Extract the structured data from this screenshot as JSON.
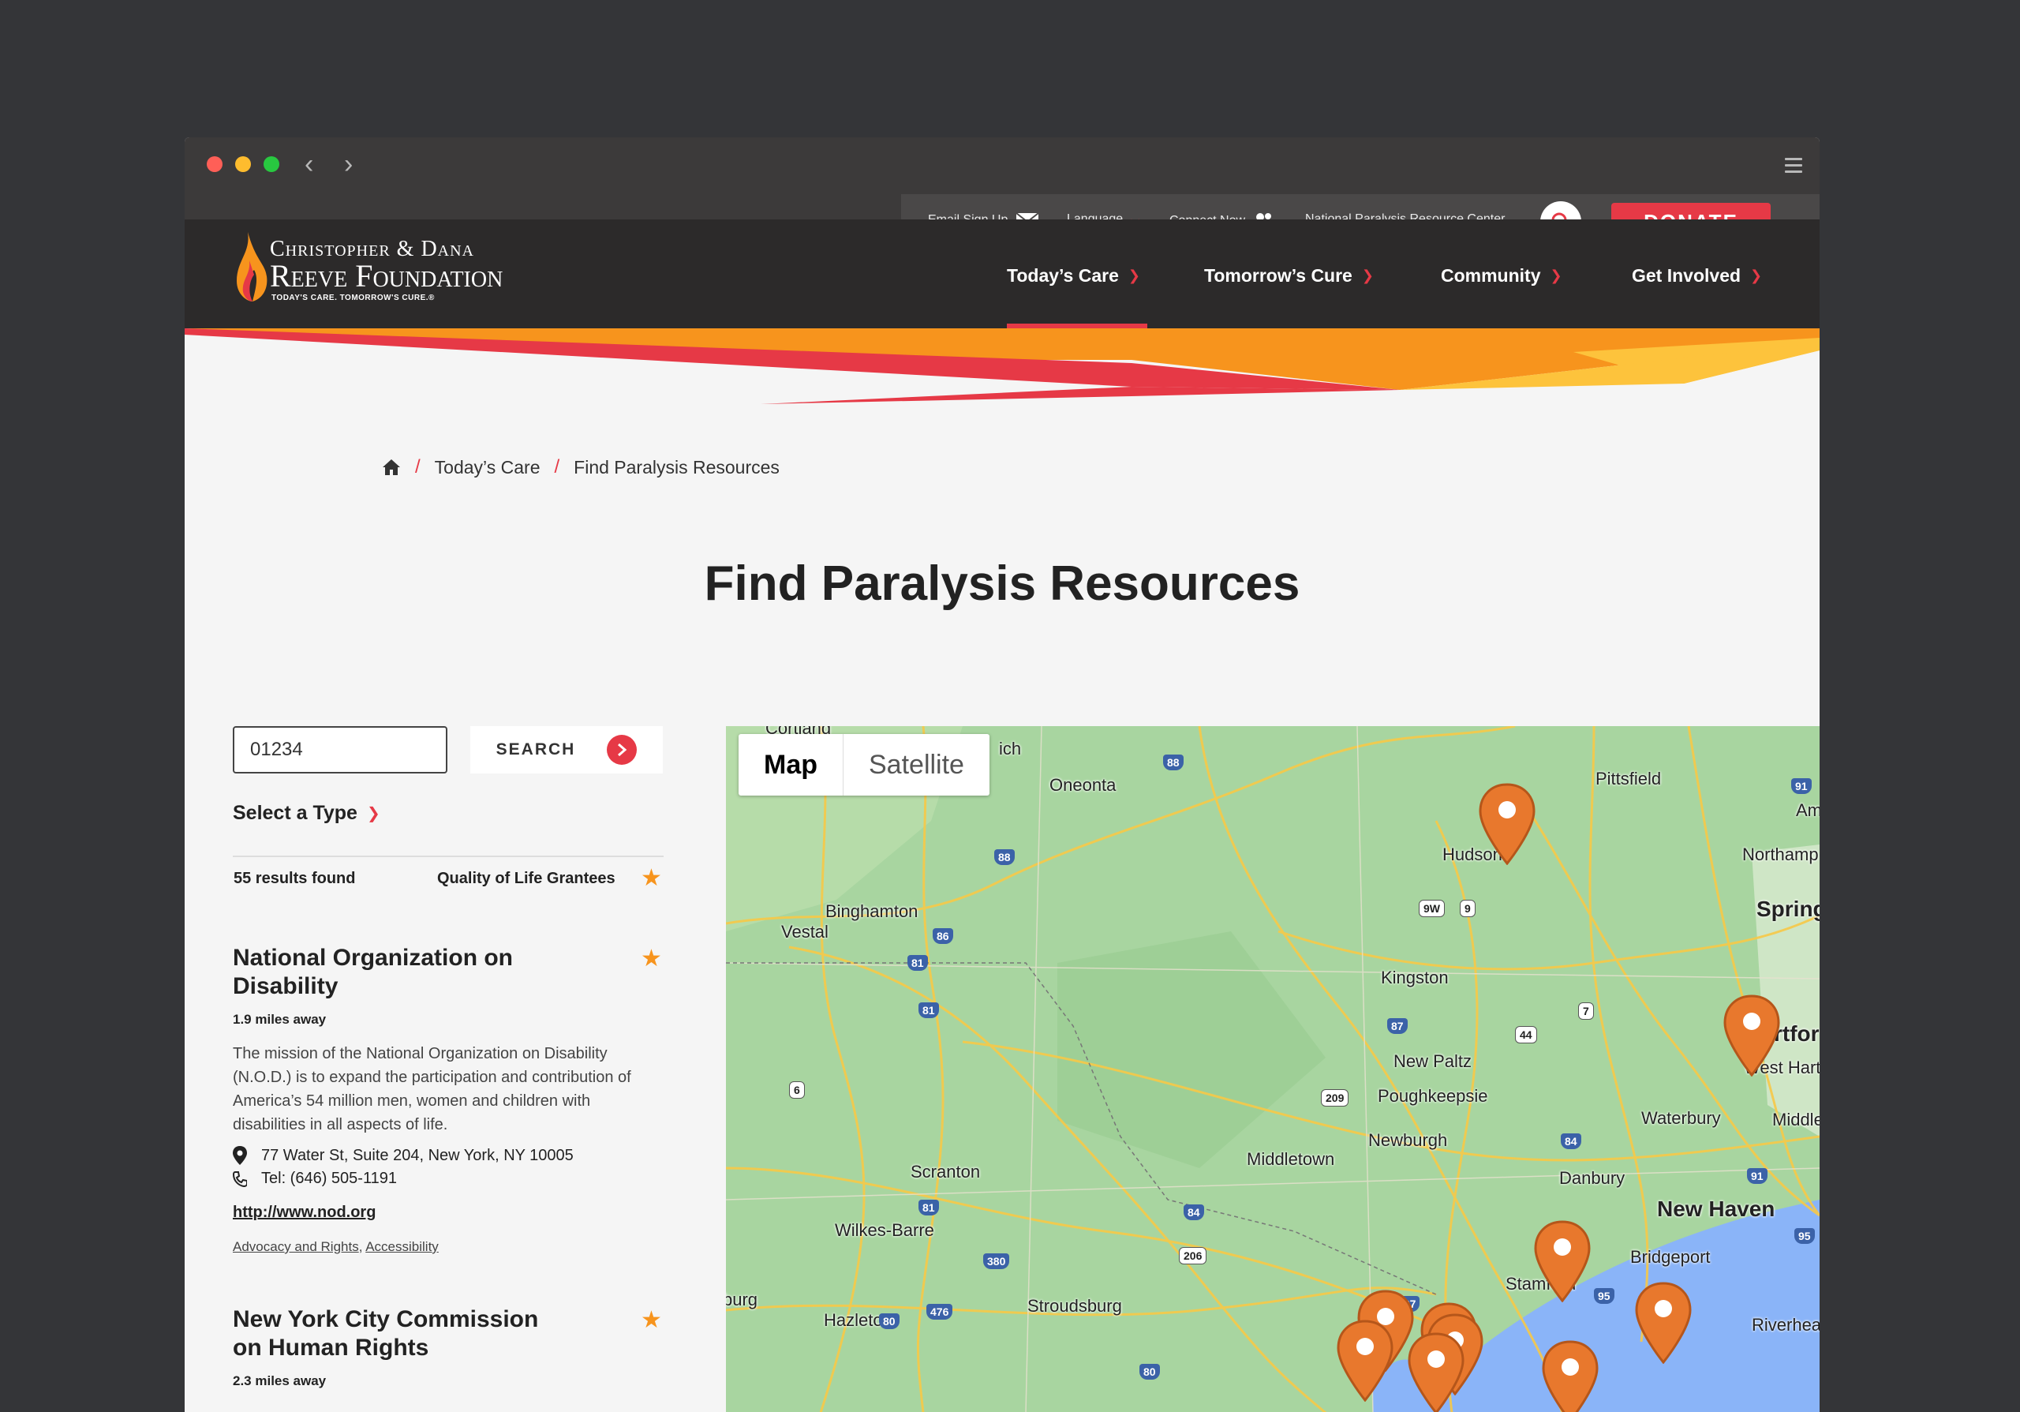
{
  "browser": {
    "back_glyph": "‹",
    "forward_glyph": "›"
  },
  "utility_nav": {
    "email_signup": "Email Sign Up",
    "language": "Language",
    "connect_now": "Connect Now",
    "resource_center": "National Paralysis Resource Center",
    "donate": "DONATE"
  },
  "logo": {
    "line1": "Christopher & Dana",
    "line2": "Reeve Foundation",
    "tagline": "TODAY'S CARE. TOMORROW'S CURE.®"
  },
  "main_nav": {
    "items": [
      {
        "label": "Today’s Care"
      },
      {
        "label": "Tomorrow’s Cure"
      },
      {
        "label": "Community"
      },
      {
        "label": "Get Involved"
      }
    ]
  },
  "breadcrumb": {
    "items": [
      "Today’s Care",
      "Find Paralysis Resources"
    ]
  },
  "page": {
    "title": "Find Paralysis Resources"
  },
  "search": {
    "zip_value": "01234",
    "button_label": "SEARCH",
    "select_type": "Select a Type",
    "results_count": "55 results found",
    "quality_label": "Quality of Life Grantees"
  },
  "results": [
    {
      "title": "National Organization on Disability",
      "distance": "1.9 miles away",
      "description": "The mission of the National Organization on Disability (N.O.D.) is to expand the participation and contribution of America’s 54 million men, women and children with disabilities in all aspects of life.",
      "address": "77 Water St, Suite 204, New York, NY 10005",
      "phone": "Tel: (646) 505-1191",
      "url": "http://www.nod.org",
      "categories": [
        "Advocacy and Rights",
        "Accessibility"
      ]
    },
    {
      "title": "New York City Commission on Human Rights",
      "distance": "2.3 miles away"
    }
  ],
  "map": {
    "toggle_map": "Map",
    "toggle_satellite": "Satellite",
    "places": [
      "Cortland",
      "Oneonta",
      "Pittsfield",
      "Am",
      "Northamp",
      "Hudson",
      "Spring",
      "Binghamton",
      "Vestal",
      "Kingston",
      "rtfor",
      "West Hartford",
      "New Paltz",
      "Poughkeepsie",
      "Waterbury",
      "Middleto",
      "Newburgh",
      "Middletown",
      "Danbury",
      "Scranton",
      "New Haven",
      "Wilkes-Barre",
      "Bridgeport",
      "Stamford",
      "Hazleton",
      "Stroudsburg",
      "Riverhea",
      "burg",
      "ich"
    ],
    "highways": [
      "88",
      "91",
      "88",
      "86",
      "81",
      "9W",
      "9",
      "87",
      "44",
      "7",
      "81",
      "6",
      "209",
      "84",
      "91",
      "84",
      "81",
      "380",
      "206",
      "287",
      "95",
      "95",
      "80",
      "476",
      "80"
    ]
  },
  "colors": {
    "accent_red": "#e63946",
    "accent_orange": "#f7941d",
    "header_dark": "#2c2a2a",
    "map_green": "#a8d5a0",
    "water_blue": "#8ab4f8"
  }
}
